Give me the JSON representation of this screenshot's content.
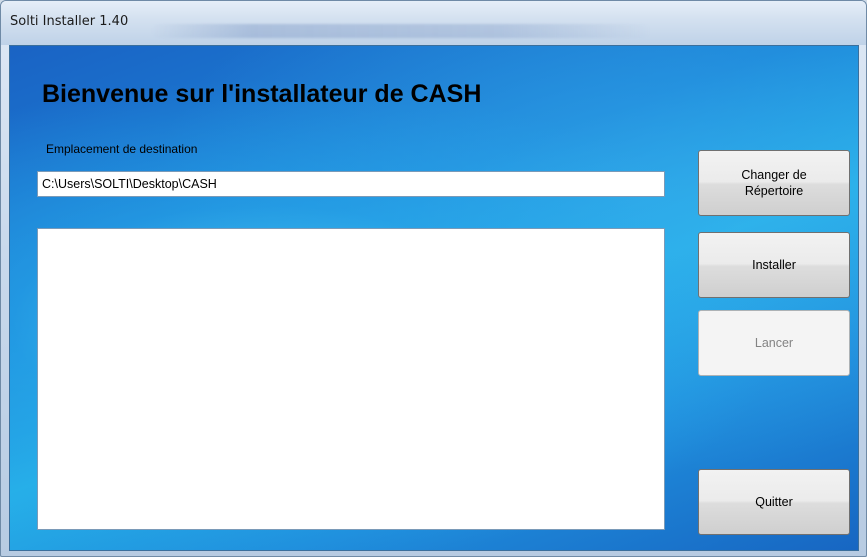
{
  "window": {
    "title": "Solti Installer 1.40"
  },
  "main": {
    "heading": "Bienvenue sur l'installateur de CASH",
    "destination_label": "Emplacement de destination",
    "destination_path": "C:\\Users\\SOLTI\\Desktop\\CASH",
    "log_text": ""
  },
  "buttons": {
    "change_dir": "Changer de Répertoire",
    "install": "Installer",
    "launch": "Lancer",
    "quit": "Quitter"
  },
  "colors": {
    "accent": "#1b84d8",
    "disabled_text": "#838383"
  }
}
